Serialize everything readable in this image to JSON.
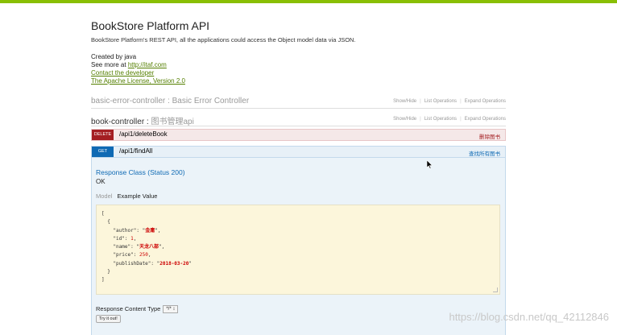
{
  "header": {
    "title": "BookStore Platform API",
    "description": "BookStore Platform's REST API, all the applications could access the Object model data via JSON.",
    "created_by": "Created by java",
    "see_more_prefix": "See more at ",
    "see_more_link": "http://itaf.com",
    "contact_link": "Contact the developer",
    "license_link": "The Apache License, Version 2.0"
  },
  "controllers": [
    {
      "name": "basic-error-controller",
      "description": "Basic Error Controller",
      "ops": [
        "Show/Hide",
        "List Operations",
        "Expand Operations"
      ]
    },
    {
      "name": "book-controller",
      "description": "图书管理api",
      "ops": [
        "Show/Hide",
        "List Operations",
        "Expand Operations"
      ]
    }
  ],
  "operations": [
    {
      "method": "DELETE",
      "path": "/api1/deleteBook",
      "summary": "删除图书",
      "color": "#a41e22"
    },
    {
      "method": "GET",
      "path": "/api1/findAll",
      "summary": "查找所有图书",
      "color": "#0f6ab4"
    }
  ],
  "response": {
    "class_title": "Response Class (Status 200)",
    "status": "OK",
    "tab_model": "Model",
    "tab_example": "Example Value",
    "example": {
      "author": "金庸",
      "id": "1",
      "name": "天龙八部",
      "price": "250",
      "publishDate": "2018-03-20"
    },
    "content_type_label": "Response Content Type",
    "content_type_value": "*/*",
    "try_button": "Try it out!"
  },
  "watermark": "https://blog.csdn.net/qq_42112846",
  "colors": {
    "topbar": "#89bf04",
    "link": "#547f00"
  }
}
